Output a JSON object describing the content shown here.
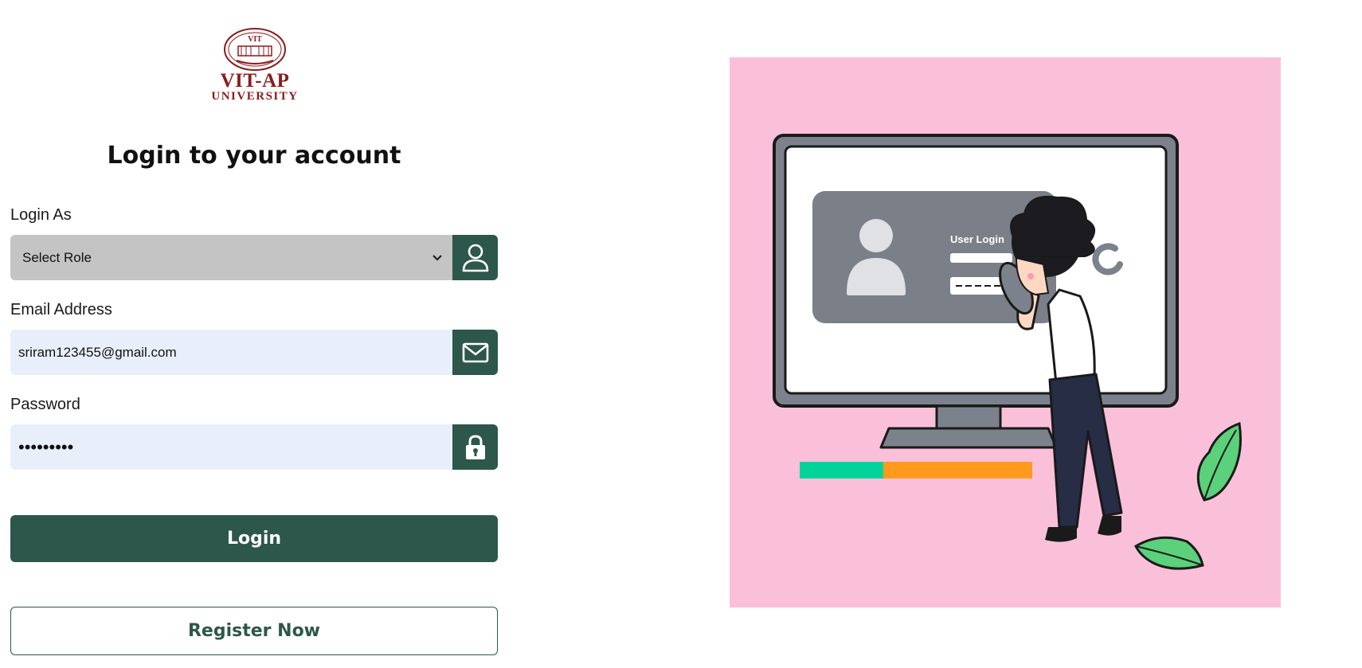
{
  "logo": {
    "seal_text": "VIT",
    "name": "VIT-AP",
    "subtitle": "UNIVERSITY"
  },
  "form": {
    "heading": "Login to your account",
    "role": {
      "label": "Login As",
      "selected": "Select Role",
      "icon": "user-icon"
    },
    "email": {
      "label": "Email Address",
      "value": "sriram123455@gmail.com",
      "icon": "mail-icon"
    },
    "password": {
      "label": "Password",
      "value": "•••••••••",
      "icon": "lock-icon"
    },
    "login_label": "Login",
    "register_label": "Register Now"
  },
  "illustration": {
    "screen_text": "User Login",
    "progress": {
      "segments": [
        {
          "color": "#00d49b",
          "fraction": 0.36
        },
        {
          "color": "#ff9a1c",
          "fraction": 0.64
        }
      ]
    }
  },
  "colors": {
    "accent": "#2d574a",
    "brand": "#8b1c1c",
    "input_bg": "#e8effb",
    "select_bg": "#c4c4c4",
    "illustration_bg": "#fbc0d9"
  }
}
